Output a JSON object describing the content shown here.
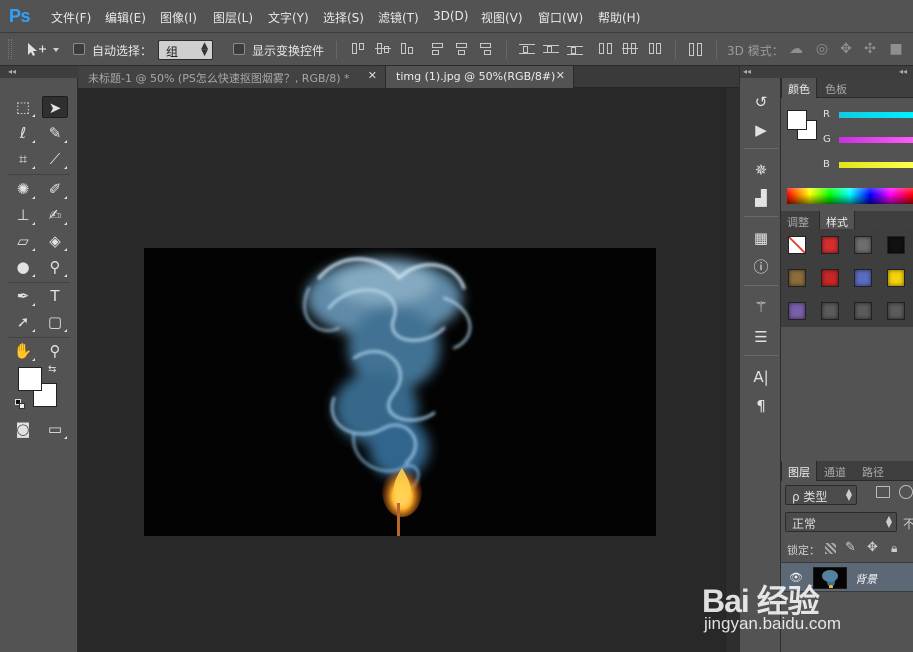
{
  "app": {
    "logo": "Ps"
  },
  "menu": [
    "文件(F)",
    "编辑(E)",
    "图像(I)",
    "图层(L)",
    "文字(Y)",
    "选择(S)",
    "滤镜(T)",
    "3D(D)",
    "视图(V)",
    "窗口(W)",
    "帮助(H)"
  ],
  "options": {
    "auto_select_label": "自动选择：",
    "auto_select_value": "组",
    "show_transform_label": "显示变换控件",
    "mode3d_label": "3D 模式："
  },
  "documents": [
    {
      "title": "未标题-1 @ 50% (PS怎么快速抠图烟雾？, RGB/8) *",
      "active": false
    },
    {
      "title": "timg (1).jpg @ 50%(RGB/8#)",
      "active": true
    }
  ],
  "tool_icons": [
    "move-tool",
    "marquee-tool",
    "lasso-tool",
    "quick-selection-tool",
    "crop-tool",
    "eyedropper-tool",
    "healing-brush-tool",
    "brush-tool",
    "clone-stamp-tool",
    "history-brush-tool",
    "eraser-tool",
    "paint-bucket-tool",
    "blur-tool",
    "dodge-tool",
    "pen-tool",
    "type-tool",
    "path-selection-tool",
    "rectangle-tool",
    "hand-tool",
    "zoom-tool"
  ],
  "tools": {
    "type_glyph": "T"
  },
  "color_panel": {
    "tabs": [
      "颜色",
      "色板"
    ],
    "channels": [
      {
        "label": "R",
        "color": "#00e5ff"
      },
      {
        "label": "G",
        "color": "#e040fb"
      },
      {
        "label": "B",
        "color": "#ffff33"
      }
    ]
  },
  "styles_panel": {
    "tabs": [
      "调整",
      "样式"
    ],
    "swatches": [
      "none",
      "#d32f2f",
      "#6e6e6e",
      "#111111",
      "#8a6d3b",
      "#c62828",
      "#5c6bc0",
      "#f4d20c",
      "#7a5fa8",
      "#5b5b5b",
      "#5b5b5b",
      "#5b5b5b"
    ]
  },
  "layers_panel": {
    "tabs": [
      "图层",
      "通道",
      "路径"
    ],
    "filter_label": "ρ 类型",
    "blend_mode": "正常",
    "opacity_label": "不",
    "lock_label": "锁定：",
    "layer_name": "背景"
  },
  "strip": {
    "char_glyph": "A|",
    "para_glyph": "¶"
  },
  "watermark": {
    "logo": "Bai 经验",
    "url": "jingyan.baidu.com"
  },
  "colors": {
    "ui_bg": "#535353",
    "canvas_bg": "#282828",
    "ps_blue": "#2fa3f7",
    "selected_layer": "#5d6877"
  }
}
